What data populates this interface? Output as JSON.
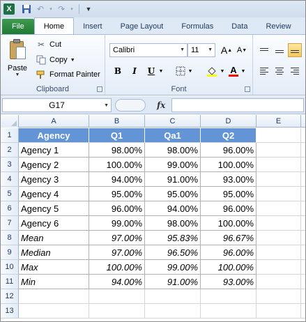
{
  "qat": {
    "app_icon_letter": "X",
    "icons": [
      "save-icon",
      "undo-icon",
      "redo-icon",
      "customize-qat-icon"
    ]
  },
  "tabs": [
    {
      "label": "File"
    },
    {
      "label": "Home"
    },
    {
      "label": "Insert"
    },
    {
      "label": "Page Layout"
    },
    {
      "label": "Formulas"
    },
    {
      "label": "Data"
    },
    {
      "label": "Review"
    }
  ],
  "ribbon": {
    "clipboard": {
      "paste": "Paste",
      "cut": "Cut",
      "copy": "Copy",
      "format_painter": "Format Painter",
      "group_label": "Clipboard"
    },
    "font": {
      "font_name": "Calibri",
      "font_size": "11",
      "grow": "A",
      "shrink": "A",
      "bold": "B",
      "italic": "I",
      "underline": "U",
      "font_color_letter": "A",
      "group_label": "Font",
      "fill_color": "#ffff00",
      "font_color": "#ff0000"
    }
  },
  "formula_bar": {
    "name_box": "G17",
    "fx": "fx",
    "formula": ""
  },
  "sheet": {
    "columns": [
      "A",
      "B",
      "C",
      "D",
      "E"
    ],
    "rows": [
      "1",
      "2",
      "3",
      "4",
      "5",
      "6",
      "7",
      "8",
      "9",
      "10",
      "11",
      "12",
      "13"
    ],
    "header_fill": "#6395d6",
    "headers": [
      "Agency",
      "Q1",
      "Qa1",
      "Q2"
    ],
    "data": [
      [
        "Agency 1",
        "98.00%",
        "98.00%",
        "96.00%"
      ],
      [
        "Agency 2",
        "100.00%",
        "99.00%",
        "100.00%"
      ],
      [
        "Agency 3",
        "94.00%",
        "91.00%",
        "93.00%"
      ],
      [
        "Agency 4",
        "95.00%",
        "95.00%",
        "95.00%"
      ],
      [
        "Agency 5",
        "96.00%",
        "94.00%",
        "96.00%"
      ],
      [
        "Agency 6",
        "99.00%",
        "98.00%",
        "100.00%"
      ],
      [
        "Mean",
        "97.00%",
        "95.83%",
        "96.67%"
      ],
      [
        "Median",
        "97.00%",
        "96.50%",
        "96.00%"
      ],
      [
        "Max",
        "100.00%",
        "99.00%",
        "100.00%"
      ],
      [
        "Min",
        "94.00%",
        "91.00%",
        "93.00%"
      ]
    ]
  }
}
